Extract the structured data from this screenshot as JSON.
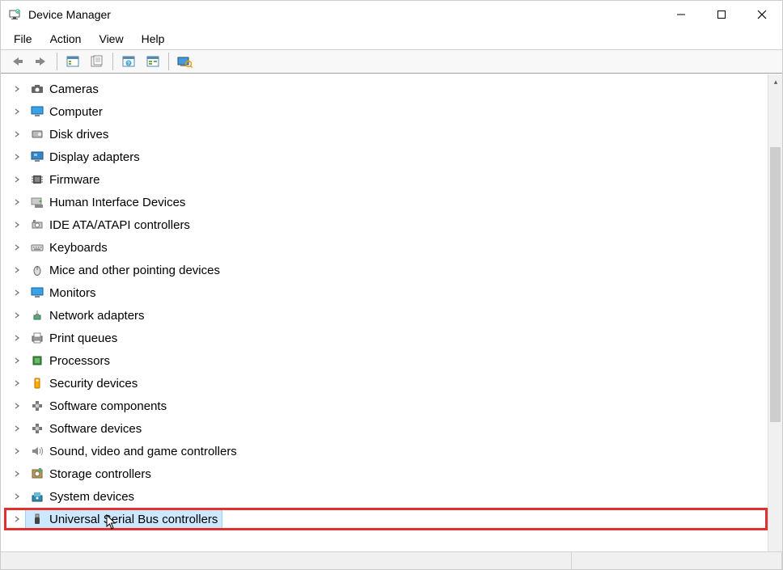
{
  "window": {
    "title": "Device Manager"
  },
  "menubar": {
    "items": [
      "File",
      "Action",
      "View",
      "Help"
    ]
  },
  "toolbar": {
    "buttons": [
      {
        "name": "back",
        "icon": "arrow-left"
      },
      {
        "name": "forward",
        "icon": "arrow-right"
      },
      {
        "sep": true
      },
      {
        "name": "show-hidden",
        "icon": "panel"
      },
      {
        "name": "properties",
        "icon": "sheet"
      },
      {
        "sep": true
      },
      {
        "name": "help-topics",
        "icon": "help"
      },
      {
        "name": "action-panel",
        "icon": "panel2"
      },
      {
        "sep": true
      },
      {
        "name": "scan-hardware",
        "icon": "monitor-scan"
      }
    ]
  },
  "tree": {
    "items": [
      {
        "label": "Cameras",
        "icon": "camera"
      },
      {
        "label": "Computer",
        "icon": "monitor"
      },
      {
        "label": "Disk drives",
        "icon": "disk"
      },
      {
        "label": "Display adapters",
        "icon": "display"
      },
      {
        "label": "Firmware",
        "icon": "chip"
      },
      {
        "label": "Human Interface Devices",
        "icon": "hid"
      },
      {
        "label": "IDE ATA/ATAPI controllers",
        "icon": "ide"
      },
      {
        "label": "Keyboards",
        "icon": "keyboard"
      },
      {
        "label": "Mice and other pointing devices",
        "icon": "mouse"
      },
      {
        "label": "Monitors",
        "icon": "monitor"
      },
      {
        "label": "Network adapters",
        "icon": "network"
      },
      {
        "label": "Print queues",
        "icon": "printer"
      },
      {
        "label": "Processors",
        "icon": "cpu"
      },
      {
        "label": "Security devices",
        "icon": "security"
      },
      {
        "label": "Software components",
        "icon": "sw"
      },
      {
        "label": "Software devices",
        "icon": "sw"
      },
      {
        "label": "Sound, video and game controllers",
        "icon": "sound"
      },
      {
        "label": "Storage controllers",
        "icon": "storage"
      },
      {
        "label": "System devices",
        "icon": "system"
      },
      {
        "label": "Universal Serial Bus controllers",
        "icon": "usb",
        "selected": true,
        "highlighted": true
      }
    ]
  }
}
